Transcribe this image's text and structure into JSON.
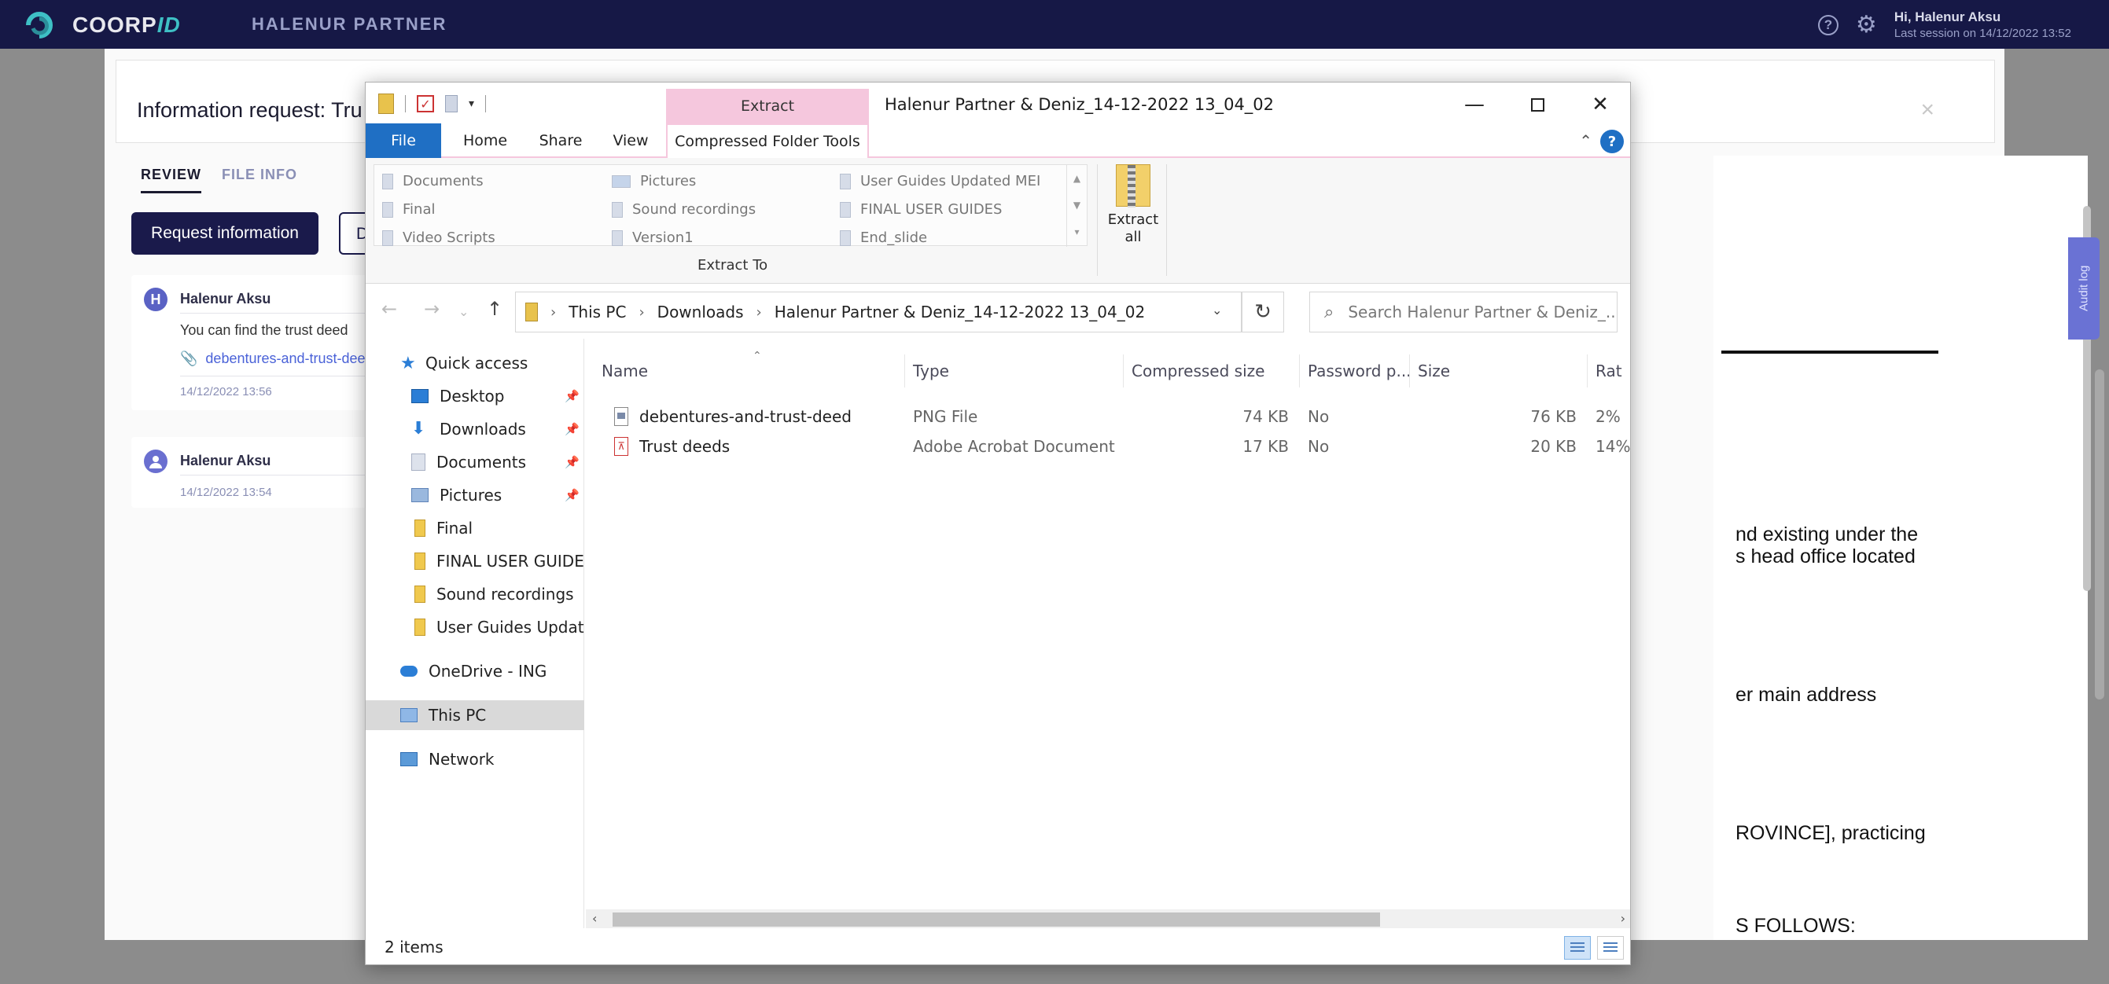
{
  "app": {
    "logo_brand": "COORP",
    "logo_suffix": "ID",
    "org_name": "HALENUR PARTNER",
    "help_icon": "question-circle-icon",
    "settings_icon": "gear-icon",
    "user_greeting": "Hi, Halenur Aksu",
    "last_session": "Last session on  14/12/2022 13:52"
  },
  "modal": {
    "title": "Information request: Tru",
    "close_glyph": "×",
    "tabs": [
      "REVIEW",
      "FILE INFO"
    ],
    "request_button": "Request information",
    "second_button": "D",
    "messages": [
      {
        "avatar": "H",
        "author": "Halenur Aksu",
        "text": "You can find the trust deed",
        "attachment": "debentures-and-trust-dee",
        "time": "14/12/2022 13:56"
      },
      {
        "avatar": "",
        "author": "Halenur Aksu",
        "time": "14/12/2022 13:54"
      }
    ],
    "document_lines": [
      "nd existing under the",
      "s head office located",
      "er main address",
      "ROVINCE], practicing",
      "S FOLLOWS:"
    ],
    "audit_log": "Audit log"
  },
  "explorer": {
    "title": "Halenur Partner & Deniz_14-12-2022 13_04_02",
    "context_tab": "Extract",
    "menu_tabs": {
      "file": "File",
      "home": "Home",
      "share": "Share",
      "view": "View",
      "compressed": "Compressed Folder Tools"
    },
    "extract_to_items": [
      [
        "Documents",
        "Pictures",
        "User Guides Updated MEI"
      ],
      [
        "Final",
        "Sound recordings",
        "FINAL USER GUIDES"
      ],
      [
        "Video Scripts",
        "Version1",
        "End_slide"
      ]
    ],
    "extract_to_label": "Extract To",
    "extract_all_line1": "Extract",
    "extract_all_line2": "all",
    "address": {
      "this_pc": "This PC",
      "downloads": "Downloads",
      "folder": "Halenur Partner & Deniz_14-12-2022 13_04_02"
    },
    "search_placeholder": "Search Halenur Partner & Deniz_...",
    "nav": {
      "quick_access": "Quick access",
      "desktop": "Desktop",
      "downloads": "Downloads",
      "documents": "Documents",
      "pictures": "Pictures",
      "final": "Final",
      "final_user_guides": "FINAL USER GUIDES",
      "sound_recordings": "Sound recordings",
      "user_guides_update": "User Guides Update",
      "onedrive": "OneDrive - ING",
      "this_pc": "This PC",
      "network": "Network"
    },
    "columns": {
      "name": "Name",
      "type": "Type",
      "compressed_size": "Compressed size",
      "password": "Password p...",
      "size": "Size",
      "ratio": "Rat"
    },
    "files": [
      {
        "name": "debentures-and-trust-deed",
        "type": "PNG File",
        "compressed": "74 KB",
        "password": "No",
        "size": "76 KB",
        "ratio": "2%"
      },
      {
        "name": "Trust deeds",
        "type": "Adobe Acrobat Document",
        "compressed": "17 KB",
        "password": "No",
        "size": "20 KB",
        "ratio": "14%"
      }
    ],
    "status": "2 items"
  }
}
